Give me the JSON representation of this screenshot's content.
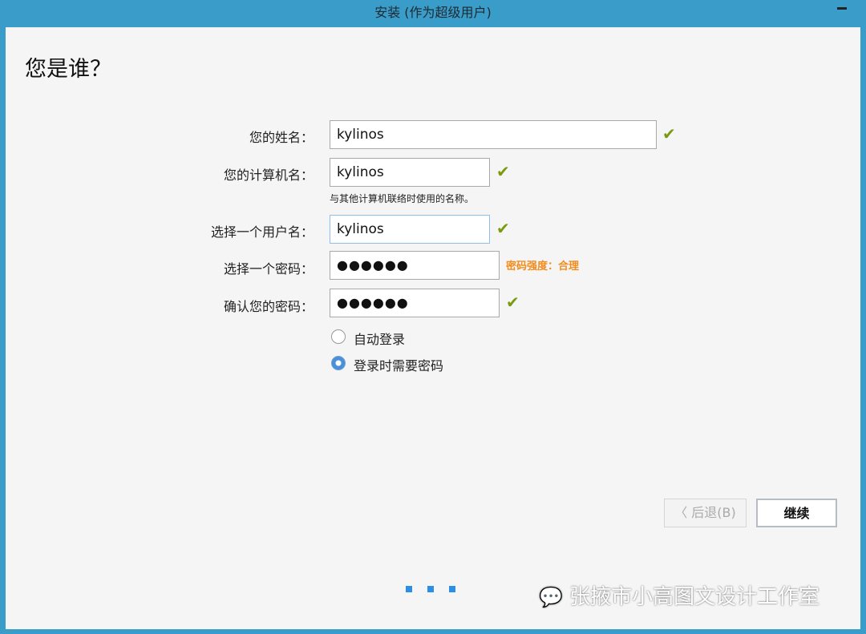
{
  "window": {
    "title": "安装 (作为超级用户)"
  },
  "page": {
    "heading": "您是谁？"
  },
  "form": {
    "name": {
      "label": "您的姓名：",
      "value": "kylinos"
    },
    "computer": {
      "label": "您的计算机名：",
      "value": "kylinos",
      "hint": "与其他计算机联络时使用的名称。"
    },
    "username": {
      "label": "选择一个用户名：",
      "value": "kylinos"
    },
    "password": {
      "label": "选择一个密码：",
      "value": "●●●●●●",
      "strength": "密码强度：合理"
    },
    "confirm": {
      "label": "确认您的密码：",
      "value": "●●●●●●"
    },
    "login_options": [
      {
        "label": "自动登录",
        "selected": false
      },
      {
        "label": "登录时需要密码",
        "selected": true
      }
    ]
  },
  "buttons": {
    "back": "〈 后退(B)",
    "next": "继续"
  },
  "watermark": "张掖市小高图文设计工作室",
  "colors": {
    "accent": "#3a9cc8",
    "check": "#7a9a10",
    "strength": "#f28c1c"
  }
}
